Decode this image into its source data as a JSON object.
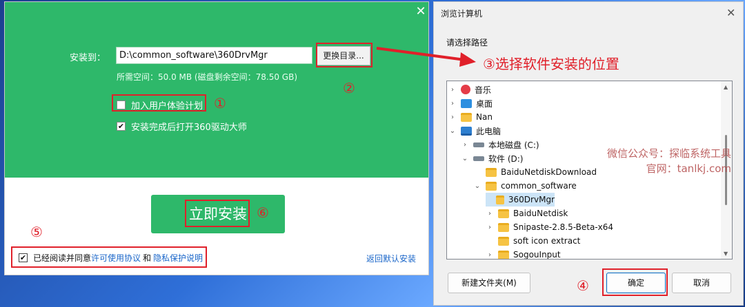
{
  "installer": {
    "install_to_label": "安装到：",
    "path_value": "D:\\common_software\\360DrvMgr",
    "change_dir_label": "更换目录...",
    "space_text": "所需空间：50.0 MB (磁盘剩余空间：78.50 GB)",
    "options": [
      {
        "label": "加入用户体验计划",
        "checked": false
      },
      {
        "label": "安装完成后打开360驱动大师",
        "checked": true
      }
    ],
    "install_button": "立即安装",
    "agree_prefix": "已经阅读并同意",
    "license_link": "许可使用协议",
    "and_text": "和",
    "privacy_link": "隐私保护说明",
    "default_install_link": "返回默认安装",
    "close_glyph": "✕"
  },
  "browse_dialog": {
    "title": "浏览计算机",
    "prompt": "请选择路径",
    "tree": [
      {
        "label": "音乐",
        "icon": "music-icon",
        "chevron": "›"
      },
      {
        "label": "桌面",
        "icon": "desktop-icon",
        "chevron": "›"
      },
      {
        "label": "Nan",
        "icon": "folder-icon",
        "chevron": "›"
      },
      {
        "label": "此电脑",
        "icon": "pc-icon",
        "chevron": "⌄"
      },
      {
        "label": "本地磁盘 (C:)",
        "icon": "drive-icon",
        "chevron": "›"
      },
      {
        "label": "软件 (D:)",
        "icon": "drive-icon",
        "chevron": "⌄"
      },
      {
        "label": "BaiduNetdiskDownload",
        "icon": "folder-icon",
        "chevron": ""
      },
      {
        "label": "common_software",
        "icon": "folder-icon",
        "chevron": "⌄"
      },
      {
        "label": "360DrvMgr",
        "icon": "folder-icon",
        "chevron": "",
        "selected": true
      },
      {
        "label": "BaiduNetdisk",
        "icon": "folder-icon",
        "chevron": "›"
      },
      {
        "label": "Snipaste-2.8.5-Beta-x64",
        "icon": "folder-icon",
        "chevron": "›"
      },
      {
        "label": "soft icon extract",
        "icon": "folder-icon",
        "chevron": ""
      },
      {
        "label": "SogouInput",
        "icon": "folder-icon",
        "chevron": "›"
      }
    ],
    "new_folder_button": "新建文件夹(M)",
    "ok_button": "确定",
    "cancel_button": "取消",
    "close_glyph": "✕"
  },
  "annotations": {
    "step1": "①",
    "step2": "②",
    "step3": "③选择软件安装的位置",
    "step4": "④",
    "step5": "⑤",
    "step6": "⑥"
  },
  "watermark": {
    "line1": "微信公众号：探临系统工具",
    "line2": "官网：tanlkj.com"
  },
  "colors": {
    "installer_green": "#2eb86a",
    "annotation_red": "#e0202a",
    "link_blue": "#1a66c9"
  }
}
